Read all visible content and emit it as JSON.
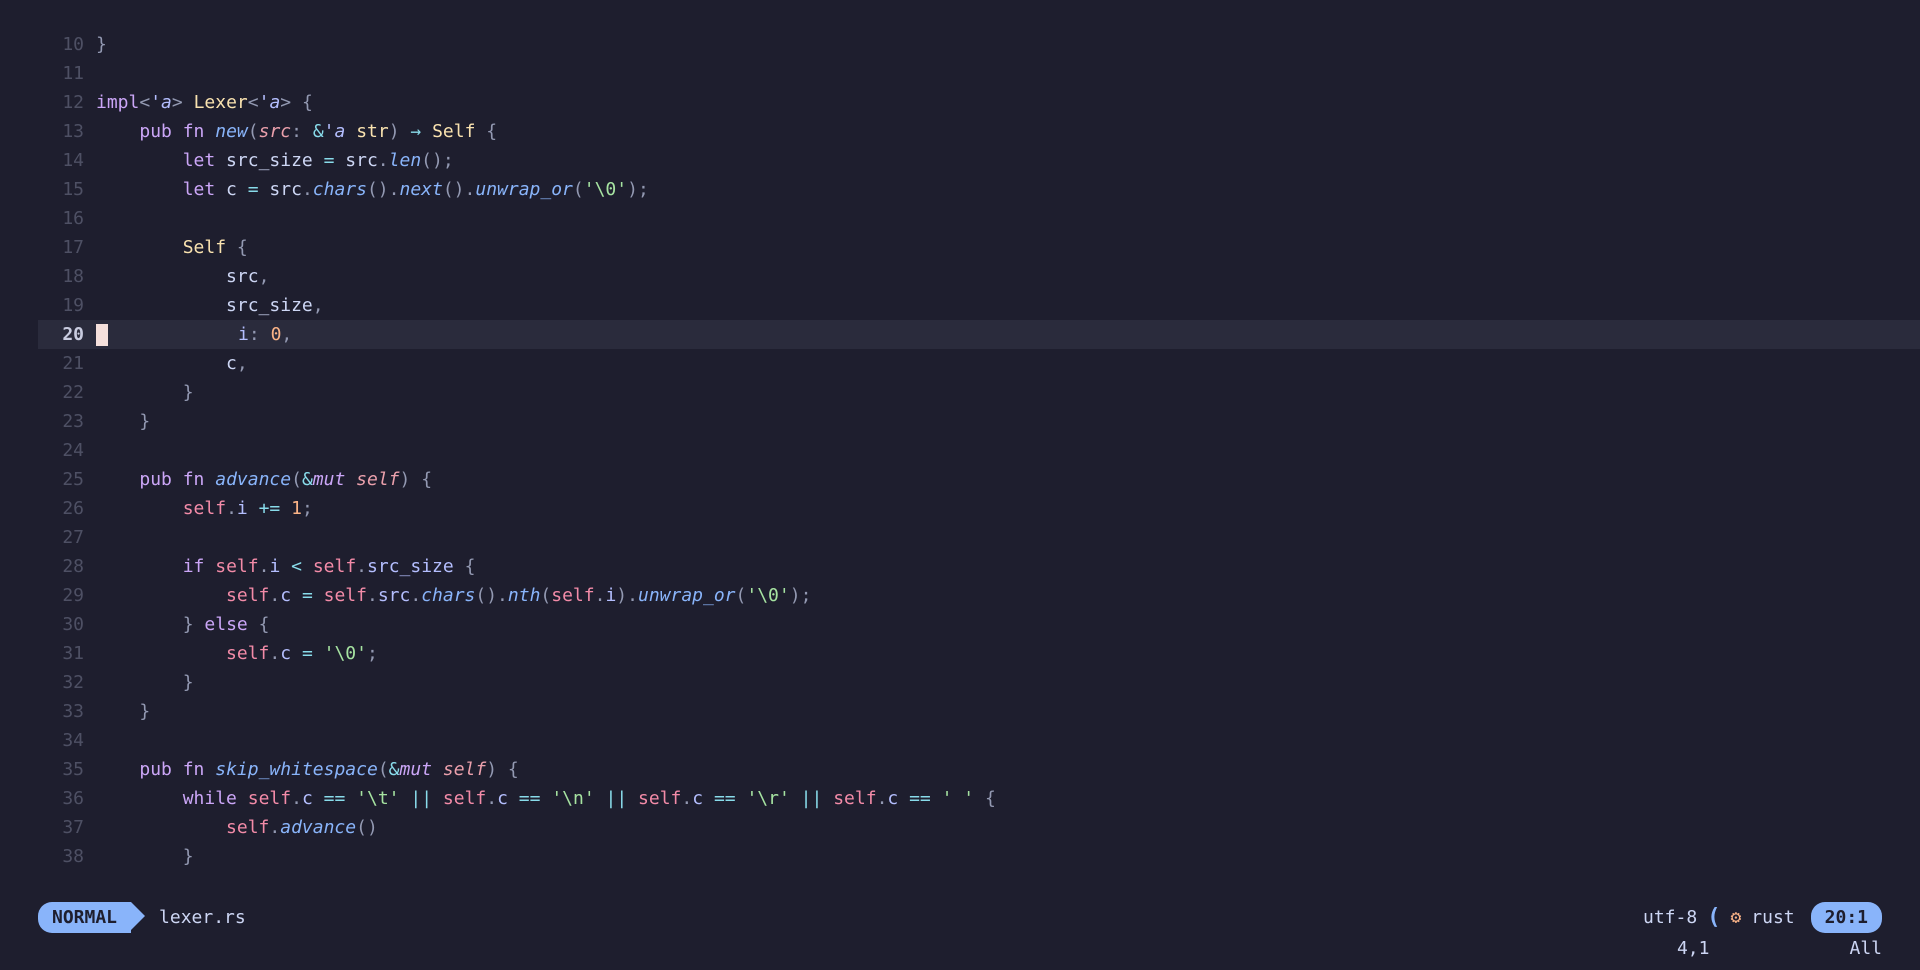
{
  "editor": {
    "current_line": 20,
    "lines": [
      {
        "num": 10,
        "tokens": [
          [
            "punct",
            "}"
          ]
        ]
      },
      {
        "num": 11,
        "tokens": []
      },
      {
        "num": 12,
        "tokens": [
          [
            "kw",
            "impl"
          ],
          [
            "punct",
            "<"
          ],
          [
            "life",
            "'a"
          ],
          [
            "punct",
            ">"
          ],
          [
            "ident",
            " "
          ],
          [
            "ty",
            "Lexer"
          ],
          [
            "punct",
            "<"
          ],
          [
            "life",
            "'a"
          ],
          [
            "punct",
            ">"
          ],
          [
            "ident",
            " "
          ],
          [
            "punct",
            "{"
          ]
        ]
      },
      {
        "num": 13,
        "tokens": [
          [
            "ident",
            "    "
          ],
          [
            "kw",
            "pub"
          ],
          [
            "ident",
            " "
          ],
          [
            "kw",
            "fn"
          ],
          [
            "ident",
            " "
          ],
          [
            "fnname",
            "new"
          ],
          [
            "punct",
            "("
          ],
          [
            "param",
            "src"
          ],
          [
            "punct",
            ":"
          ],
          [
            "ident",
            " "
          ],
          [
            "op",
            "&"
          ],
          [
            "life",
            "'a"
          ],
          [
            "ident",
            " "
          ],
          [
            "ty",
            "str"
          ],
          [
            "punct",
            ")"
          ],
          [
            "ident",
            " "
          ],
          [
            "op",
            "→"
          ],
          [
            "ident",
            " "
          ],
          [
            "ty",
            "Self"
          ],
          [
            "ident",
            " "
          ],
          [
            "punct",
            "{"
          ]
        ]
      },
      {
        "num": 14,
        "tokens": [
          [
            "ident",
            "        "
          ],
          [
            "kw",
            "let"
          ],
          [
            "ident",
            " src_size "
          ],
          [
            "op",
            "="
          ],
          [
            "ident",
            " src"
          ],
          [
            "punct",
            "."
          ],
          [
            "fnname",
            "len"
          ],
          [
            "punct",
            "();"
          ]
        ]
      },
      {
        "num": 15,
        "tokens": [
          [
            "ident",
            "        "
          ],
          [
            "kw",
            "let"
          ],
          [
            "ident",
            " c "
          ],
          [
            "op",
            "="
          ],
          [
            "ident",
            " src"
          ],
          [
            "punct",
            "."
          ],
          [
            "fnname",
            "chars"
          ],
          [
            "punct",
            "()."
          ],
          [
            "fnname",
            "next"
          ],
          [
            "punct",
            "()."
          ],
          [
            "fnname",
            "unwrap_or"
          ],
          [
            "punct",
            "("
          ],
          [
            "str",
            "'\\0'"
          ],
          [
            "punct",
            ");"
          ]
        ]
      },
      {
        "num": 16,
        "tokens": []
      },
      {
        "num": 17,
        "tokens": [
          [
            "ident",
            "        "
          ],
          [
            "ty",
            "Self"
          ],
          [
            "ident",
            " "
          ],
          [
            "punct",
            "{"
          ]
        ]
      },
      {
        "num": 18,
        "tokens": [
          [
            "ident",
            "            src"
          ],
          [
            "punct",
            ","
          ]
        ]
      },
      {
        "num": 19,
        "tokens": [
          [
            "ident",
            "            src_size"
          ],
          [
            "punct",
            ","
          ]
        ]
      },
      {
        "num": 20,
        "tokens": [
          [
            "ident",
            "            "
          ],
          [
            "prop",
            "i"
          ],
          [
            "punct",
            ":"
          ],
          [
            "ident",
            " "
          ],
          [
            "num",
            "0"
          ],
          [
            "punct",
            ","
          ]
        ]
      },
      {
        "num": 21,
        "tokens": [
          [
            "ident",
            "            c"
          ],
          [
            "punct",
            ","
          ]
        ]
      },
      {
        "num": 22,
        "tokens": [
          [
            "ident",
            "        "
          ],
          [
            "punct",
            "}"
          ]
        ]
      },
      {
        "num": 23,
        "tokens": [
          [
            "ident",
            "    "
          ],
          [
            "punct",
            "}"
          ]
        ]
      },
      {
        "num": 24,
        "tokens": []
      },
      {
        "num": 25,
        "tokens": [
          [
            "ident",
            "    "
          ],
          [
            "kw",
            "pub"
          ],
          [
            "ident",
            " "
          ],
          [
            "kw",
            "fn"
          ],
          [
            "ident",
            " "
          ],
          [
            "fnname",
            "advance"
          ],
          [
            "punct",
            "("
          ],
          [
            "op",
            "&"
          ],
          [
            "kw2",
            "mut"
          ],
          [
            "ident",
            " "
          ],
          [
            "param",
            "self"
          ],
          [
            "punct",
            ")"
          ],
          [
            "ident",
            " "
          ],
          [
            "punct",
            "{"
          ]
        ]
      },
      {
        "num": 26,
        "tokens": [
          [
            "ident",
            "        "
          ],
          [
            "self",
            "self"
          ],
          [
            "punct",
            "."
          ],
          [
            "prop",
            "i"
          ],
          [
            "ident",
            " "
          ],
          [
            "op",
            "+="
          ],
          [
            "ident",
            " "
          ],
          [
            "num",
            "1"
          ],
          [
            "punct",
            ";"
          ]
        ]
      },
      {
        "num": 27,
        "tokens": []
      },
      {
        "num": 28,
        "tokens": [
          [
            "ident",
            "        "
          ],
          [
            "kw",
            "if"
          ],
          [
            "ident",
            " "
          ],
          [
            "self",
            "self"
          ],
          [
            "punct",
            "."
          ],
          [
            "prop",
            "i"
          ],
          [
            "ident",
            " "
          ],
          [
            "op",
            "<"
          ],
          [
            "ident",
            " "
          ],
          [
            "self",
            "self"
          ],
          [
            "punct",
            "."
          ],
          [
            "prop",
            "src_size"
          ],
          [
            "ident",
            " "
          ],
          [
            "punct",
            "{"
          ]
        ]
      },
      {
        "num": 29,
        "tokens": [
          [
            "ident",
            "            "
          ],
          [
            "self",
            "self"
          ],
          [
            "punct",
            "."
          ],
          [
            "prop",
            "c"
          ],
          [
            "ident",
            " "
          ],
          [
            "op",
            "="
          ],
          [
            "ident",
            " "
          ],
          [
            "self",
            "self"
          ],
          [
            "punct",
            "."
          ],
          [
            "prop",
            "src"
          ],
          [
            "punct",
            "."
          ],
          [
            "fnname",
            "chars"
          ],
          [
            "punct",
            "()."
          ],
          [
            "fnname",
            "nth"
          ],
          [
            "punct",
            "("
          ],
          [
            "self",
            "self"
          ],
          [
            "punct",
            "."
          ],
          [
            "prop",
            "i"
          ],
          [
            "punct",
            ")."
          ],
          [
            "fnname",
            "unwrap_or"
          ],
          [
            "punct",
            "("
          ],
          [
            "str",
            "'\\0'"
          ],
          [
            "punct",
            ");"
          ]
        ]
      },
      {
        "num": 30,
        "tokens": [
          [
            "ident",
            "        "
          ],
          [
            "punct",
            "}"
          ],
          [
            "ident",
            " "
          ],
          [
            "kw",
            "else"
          ],
          [
            "ident",
            " "
          ],
          [
            "punct",
            "{"
          ]
        ]
      },
      {
        "num": 31,
        "tokens": [
          [
            "ident",
            "            "
          ],
          [
            "self",
            "self"
          ],
          [
            "punct",
            "."
          ],
          [
            "prop",
            "c"
          ],
          [
            "ident",
            " "
          ],
          [
            "op",
            "="
          ],
          [
            "ident",
            " "
          ],
          [
            "str",
            "'\\0'"
          ],
          [
            "punct",
            ";"
          ]
        ]
      },
      {
        "num": 32,
        "tokens": [
          [
            "ident",
            "        "
          ],
          [
            "punct",
            "}"
          ]
        ]
      },
      {
        "num": 33,
        "tokens": [
          [
            "ident",
            "    "
          ],
          [
            "punct",
            "}"
          ]
        ]
      },
      {
        "num": 34,
        "tokens": []
      },
      {
        "num": 35,
        "tokens": [
          [
            "ident",
            "    "
          ],
          [
            "kw",
            "pub"
          ],
          [
            "ident",
            " "
          ],
          [
            "kw",
            "fn"
          ],
          [
            "ident",
            " "
          ],
          [
            "fnname",
            "skip_whitespace"
          ],
          [
            "punct",
            "("
          ],
          [
            "op",
            "&"
          ],
          [
            "kw2",
            "mut"
          ],
          [
            "ident",
            " "
          ],
          [
            "param",
            "self"
          ],
          [
            "punct",
            ")"
          ],
          [
            "ident",
            " "
          ],
          [
            "punct",
            "{"
          ]
        ]
      },
      {
        "num": 36,
        "tokens": [
          [
            "ident",
            "        "
          ],
          [
            "kw",
            "while"
          ],
          [
            "ident",
            " "
          ],
          [
            "self",
            "self"
          ],
          [
            "punct",
            "."
          ],
          [
            "prop",
            "c"
          ],
          [
            "ident",
            " "
          ],
          [
            "op",
            "=="
          ],
          [
            "ident",
            " "
          ],
          [
            "str",
            "'\\t'"
          ],
          [
            "ident",
            " "
          ],
          [
            "op",
            "||"
          ],
          [
            "ident",
            " "
          ],
          [
            "self",
            "self"
          ],
          [
            "punct",
            "."
          ],
          [
            "prop",
            "c"
          ],
          [
            "ident",
            " "
          ],
          [
            "op",
            "=="
          ],
          [
            "ident",
            " "
          ],
          [
            "str",
            "'\\n'"
          ],
          [
            "ident",
            " "
          ],
          [
            "op",
            "||"
          ],
          [
            "ident",
            " "
          ],
          [
            "self",
            "self"
          ],
          [
            "punct",
            "."
          ],
          [
            "prop",
            "c"
          ],
          [
            "ident",
            " "
          ],
          [
            "op",
            "=="
          ],
          [
            "ident",
            " "
          ],
          [
            "str",
            "'\\r'"
          ],
          [
            "ident",
            " "
          ],
          [
            "op",
            "||"
          ],
          [
            "ident",
            " "
          ],
          [
            "self",
            "self"
          ],
          [
            "punct",
            "."
          ],
          [
            "prop",
            "c"
          ],
          [
            "ident",
            " "
          ],
          [
            "op",
            "=="
          ],
          [
            "ident",
            " "
          ],
          [
            "str",
            "' '"
          ],
          [
            "ident",
            " "
          ],
          [
            "punct",
            "{"
          ]
        ]
      },
      {
        "num": 37,
        "tokens": [
          [
            "ident",
            "            "
          ],
          [
            "self",
            "self"
          ],
          [
            "punct",
            "."
          ],
          [
            "fnname",
            "advance"
          ],
          [
            "punct",
            "()"
          ]
        ]
      },
      {
        "num": 38,
        "tokens": [
          [
            "ident",
            "        "
          ],
          [
            "punct",
            "}"
          ]
        ]
      }
    ]
  },
  "status": {
    "mode": "NORMAL",
    "filename": "lexer.rs",
    "encoding": "utf-8",
    "rust_icon": "⚙",
    "filetype": "rust",
    "position": "20:1",
    "ruler_pos": "4,1",
    "ruler_pct": "All"
  }
}
